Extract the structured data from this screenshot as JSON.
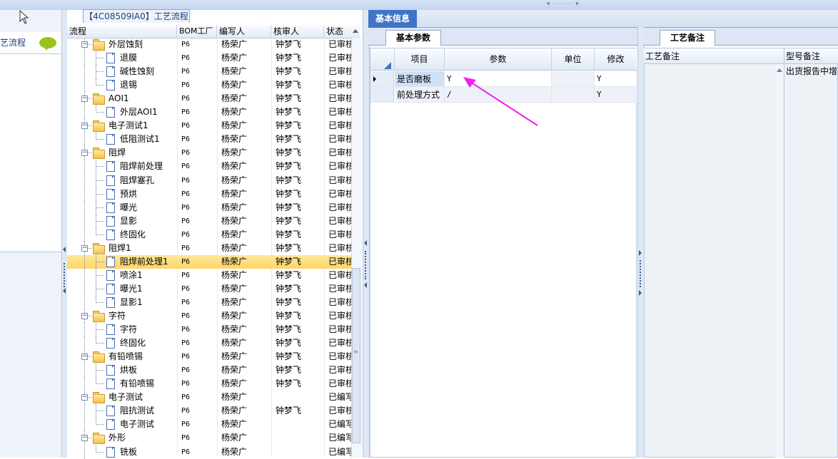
{
  "left_panel": {
    "label": "艺流程"
  },
  "tree_panel": {
    "tab_title": "【4C08509IA0】工艺流程",
    "columns": [
      "流程",
      "BOM工厂",
      "编写人",
      "核审人",
      "状态"
    ],
    "rows": [
      {
        "level": 1,
        "type": "folder",
        "name": "外层蚀刻",
        "bom": "P6",
        "writer": "杨荣广",
        "checker": "钟梦飞",
        "status": "已审核"
      },
      {
        "level": 2,
        "type": "doc",
        "name": "退膜",
        "bom": "P6",
        "writer": "杨荣广",
        "checker": "钟梦飞",
        "status": "已审核"
      },
      {
        "level": 2,
        "type": "doc",
        "name": "碱性蚀刻",
        "bom": "P6",
        "writer": "杨荣广",
        "checker": "钟梦飞",
        "status": "已审核"
      },
      {
        "level": 2,
        "type": "doc",
        "name": "退锡",
        "bom": "P6",
        "writer": "杨荣广",
        "checker": "钟梦飞",
        "status": "已审核"
      },
      {
        "level": 1,
        "type": "folder",
        "name": "AOI1",
        "bom": "P6",
        "writer": "杨荣广",
        "checker": "钟梦飞",
        "status": "已审核"
      },
      {
        "level": 2,
        "type": "doc",
        "name": "外层AOI1",
        "bom": "P6",
        "writer": "杨荣广",
        "checker": "钟梦飞",
        "status": "已审核"
      },
      {
        "level": 1,
        "type": "folder",
        "name": "电子测试1",
        "bom": "P6",
        "writer": "杨荣广",
        "checker": "钟梦飞",
        "status": "已审核"
      },
      {
        "level": 2,
        "type": "doc",
        "name": "低阻测试1",
        "bom": "P6",
        "writer": "杨荣广",
        "checker": "钟梦飞",
        "status": "已审核"
      },
      {
        "level": 1,
        "type": "folder",
        "name": "阻焊",
        "bom": "P6",
        "writer": "杨荣广",
        "checker": "钟梦飞",
        "status": "已审核"
      },
      {
        "level": 2,
        "type": "doc",
        "name": "阻焊前处理",
        "bom": "P6",
        "writer": "杨荣广",
        "checker": "钟梦飞",
        "status": "已审核"
      },
      {
        "level": 2,
        "type": "doc",
        "name": "阻焊塞孔",
        "bom": "P6",
        "writer": "杨荣广",
        "checker": "钟梦飞",
        "status": "已审核"
      },
      {
        "level": 2,
        "type": "doc",
        "name": "预烘",
        "bom": "P6",
        "writer": "杨荣广",
        "checker": "钟梦飞",
        "status": "已审核"
      },
      {
        "level": 2,
        "type": "doc",
        "name": "曝光",
        "bom": "P6",
        "writer": "杨荣广",
        "checker": "钟梦飞",
        "status": "已审核"
      },
      {
        "level": 2,
        "type": "doc",
        "name": "显影",
        "bom": "P6",
        "writer": "杨荣广",
        "checker": "钟梦飞",
        "status": "已审核"
      },
      {
        "level": 2,
        "type": "doc",
        "name": "终固化",
        "bom": "P6",
        "writer": "杨荣广",
        "checker": "钟梦飞",
        "status": "已审核"
      },
      {
        "level": 1,
        "type": "folder",
        "name": "阻焊1",
        "bom": "P6",
        "writer": "杨荣广",
        "checker": "钟梦飞",
        "status": "已审核"
      },
      {
        "level": 2,
        "type": "doc",
        "name": "阻焊前处理1",
        "bom": "P6",
        "writer": "杨荣广",
        "checker": "钟梦飞",
        "status": "已审核",
        "selected": true
      },
      {
        "level": 2,
        "type": "doc",
        "name": "喷涂1",
        "bom": "P6",
        "writer": "杨荣广",
        "checker": "钟梦飞",
        "status": "已审核"
      },
      {
        "level": 2,
        "type": "doc",
        "name": "曝光1",
        "bom": "P6",
        "writer": "杨荣广",
        "checker": "钟梦飞",
        "status": "已审核"
      },
      {
        "level": 2,
        "type": "doc",
        "name": "显影1",
        "bom": "P6",
        "writer": "杨荣广",
        "checker": "钟梦飞",
        "status": "已审核"
      },
      {
        "level": 1,
        "type": "folder",
        "name": "字符",
        "bom": "P6",
        "writer": "杨荣广",
        "checker": "钟梦飞",
        "status": "已审核"
      },
      {
        "level": 2,
        "type": "doc",
        "name": "字符",
        "bom": "P6",
        "writer": "杨荣广",
        "checker": "钟梦飞",
        "status": "已审核"
      },
      {
        "level": 2,
        "type": "doc",
        "name": "终固化",
        "bom": "P6",
        "writer": "杨荣广",
        "checker": "钟梦飞",
        "status": "已审核"
      },
      {
        "level": 1,
        "type": "folder",
        "name": "有铅喷锡",
        "bom": "P6",
        "writer": "杨荣广",
        "checker": "钟梦飞",
        "status": "已审核"
      },
      {
        "level": 2,
        "type": "doc",
        "name": "烘板",
        "bom": "P6",
        "writer": "杨荣广",
        "checker": "钟梦飞",
        "status": "已审核"
      },
      {
        "level": 2,
        "type": "doc",
        "name": "有铅喷锡",
        "bom": "P6",
        "writer": "杨荣广",
        "checker": "钟梦飞",
        "status": "已审核"
      },
      {
        "level": 1,
        "type": "folder",
        "name": "电子测试",
        "bom": "P6",
        "writer": "杨荣广",
        "checker": "",
        "status": "已编写"
      },
      {
        "level": 2,
        "type": "doc",
        "name": "阻抗测试",
        "bom": "P6",
        "writer": "杨荣广",
        "checker": "钟梦飞",
        "status": "已审核"
      },
      {
        "level": 2,
        "type": "doc",
        "name": "电子测试",
        "bom": "P6",
        "writer": "杨荣广",
        "checker": "",
        "status": "已编写"
      },
      {
        "level": 1,
        "type": "folder",
        "name": "外形",
        "bom": "P6",
        "writer": "杨荣广",
        "checker": "",
        "status": "已编写"
      },
      {
        "level": 2,
        "type": "doc",
        "name": "铣板",
        "bom": "P6",
        "writer": "杨荣广",
        "checker": "",
        "status": "已编写"
      }
    ]
  },
  "info_panel": {
    "tab": "基本信息",
    "subtab": "基本参数",
    "columns": [
      "项目",
      "参数",
      "单位",
      "修改"
    ],
    "rows": [
      {
        "item": "是否磨板",
        "param": "Y",
        "unit": "",
        "modify": "Y"
      },
      {
        "item": "前处理方式",
        "param": "/",
        "unit": "",
        "modify": "Y"
      }
    ]
  },
  "remark_panel": {
    "tab": "工艺备注",
    "col1": "工艺备注",
    "col2": "型号备注",
    "value": "出货报告中增"
  },
  "colors": {
    "accent": "#3f74c8",
    "selection": "#ffd567",
    "annotation": "#ee22ee"
  }
}
